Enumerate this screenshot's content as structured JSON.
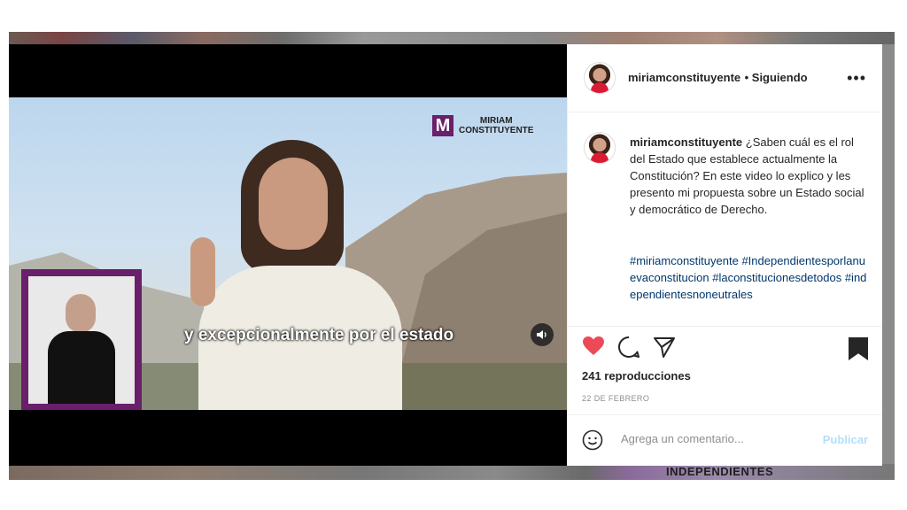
{
  "post": {
    "username": "miriamconstituyente",
    "follow_status": "• Siguiendo",
    "caption": {
      "username": "miriamconstituyente",
      "text": "¿Saben cuál es el rol del Estado que establece actualmente la Constitución? En este video lo explico y les presento mi propuesta sobre un Estado social y democrático de Derecho.",
      "hashtags": "#miriamconstituyente #Independientesporlanuevaconstitucion #laconstitucionesdetodos #independientesnoneutrales"
    },
    "views": "241 reproducciones",
    "date": "22 DE FEBRERO",
    "comment_placeholder": "Agrega un comentario...",
    "publish_label": "Publicar"
  },
  "video": {
    "logo_line1": "MIRIAM",
    "logo_line2": "CONSTITUYENTE",
    "logo_mark": "M",
    "subtitle": "y excepcionalmente por el estado"
  },
  "background": {
    "banner_text": "INDEPENDIENTES"
  },
  "icons": {
    "like": "heart-icon",
    "comment": "comment-icon",
    "share": "share-icon",
    "save": "bookmark-icon",
    "more": "more-icon",
    "sound": "sound-icon",
    "emoji": "emoji-icon"
  },
  "colors": {
    "like_active": "#ed4956",
    "hashtag": "#00376b",
    "publish_disabled": "#b2dffc",
    "brand_purple": "#6a1f6a"
  }
}
